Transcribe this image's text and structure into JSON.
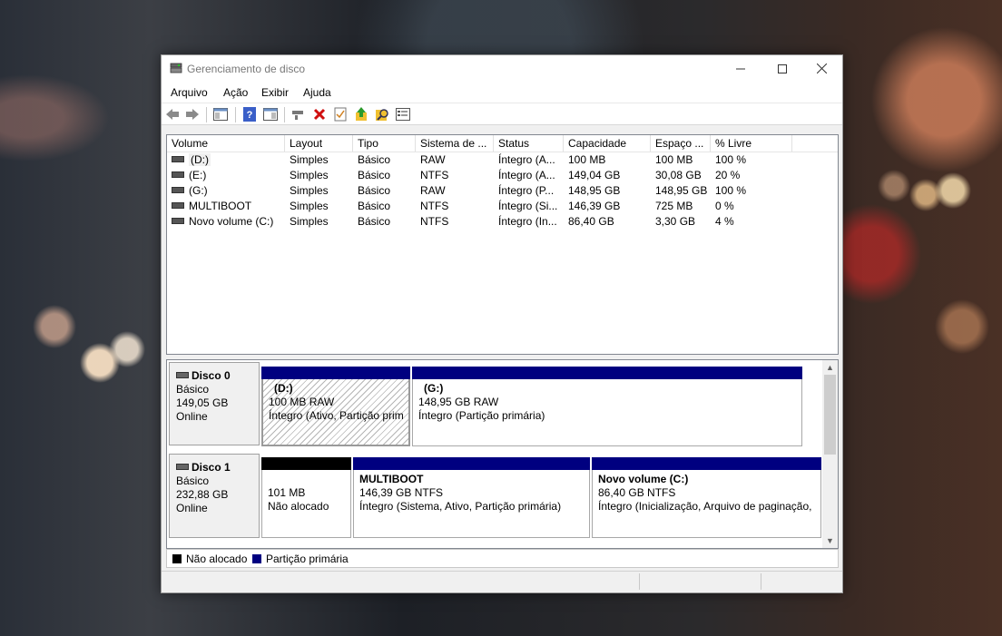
{
  "window": {
    "title": "Gerenciamento de disco"
  },
  "menu": [
    "Arquivo",
    "Ação",
    "Exibir",
    "Ajuda"
  ],
  "toolbar": [
    "back-icon",
    "forward-icon",
    "console-tree-icon",
    "help-icon",
    "properties-icon",
    "connect-icon",
    "delete-icon",
    "check-icon",
    "import-icon",
    "search-icon",
    "console-icon"
  ],
  "columns": [
    "Volume",
    "Layout",
    "Tipo",
    "Sistema de ...",
    "Status",
    "Capacidade",
    "Espaço ...",
    "% Livre"
  ],
  "volumes": [
    [
      "(D:)",
      "Simples",
      "Básico",
      "RAW",
      "Íntegro (A...",
      "100 MB",
      "100 MB",
      "100 %"
    ],
    [
      "(E:)",
      "Simples",
      "Básico",
      "NTFS",
      "Íntegro (A...",
      "149,04 GB",
      "30,08 GB",
      "20 %"
    ],
    [
      "(G:)",
      "Simples",
      "Básico",
      "RAW",
      "Íntegro (P...",
      "148,95 GB",
      "148,95 GB",
      "100 %"
    ],
    [
      "MULTIBOOT",
      "Simples",
      "Básico",
      "NTFS",
      "Íntegro (Si...",
      "146,39 GB",
      "725 MB",
      "0 %"
    ],
    [
      "Novo volume (C:)",
      "Simples",
      "Básico",
      "NTFS",
      "Íntegro (In...",
      "86,40 GB",
      "3,30 GB",
      "4 %"
    ]
  ],
  "disks": [
    {
      "name": "Disco 0",
      "type": "Básico",
      "size": "149,05 GB",
      "state": "Online",
      "partitions": [
        {
          "title": "(D:)",
          "size": "100 MB RAW",
          "status": "Íntegro (Ativo, Partição prim"
        },
        {
          "title": "(G:)",
          "size": "148,95 GB RAW",
          "status": "Íntegro (Partição primária)"
        }
      ]
    },
    {
      "name": "Disco 1",
      "type": "Básico",
      "size": "232,88 GB",
      "state": "Online",
      "partitions": [
        {
          "title": "",
          "size": "101 MB",
          "status": "Não alocado"
        },
        {
          "title": "MULTIBOOT",
          "size": "146,39 GB NTFS",
          "status": "Íntegro (Sistema, Ativo, Partição primária)"
        },
        {
          "title": "Novo volume  (C:)",
          "size": "86,40 GB NTFS",
          "status": "Íntegro (Inicialização, Arquivo de paginação,"
        }
      ]
    }
  ],
  "legend": {
    "unallocated": "Não alocado",
    "primary": "Partição primária"
  },
  "colors": {
    "primary": "#000080",
    "unallocated": "#000000",
    "selection": "#0078d7"
  }
}
